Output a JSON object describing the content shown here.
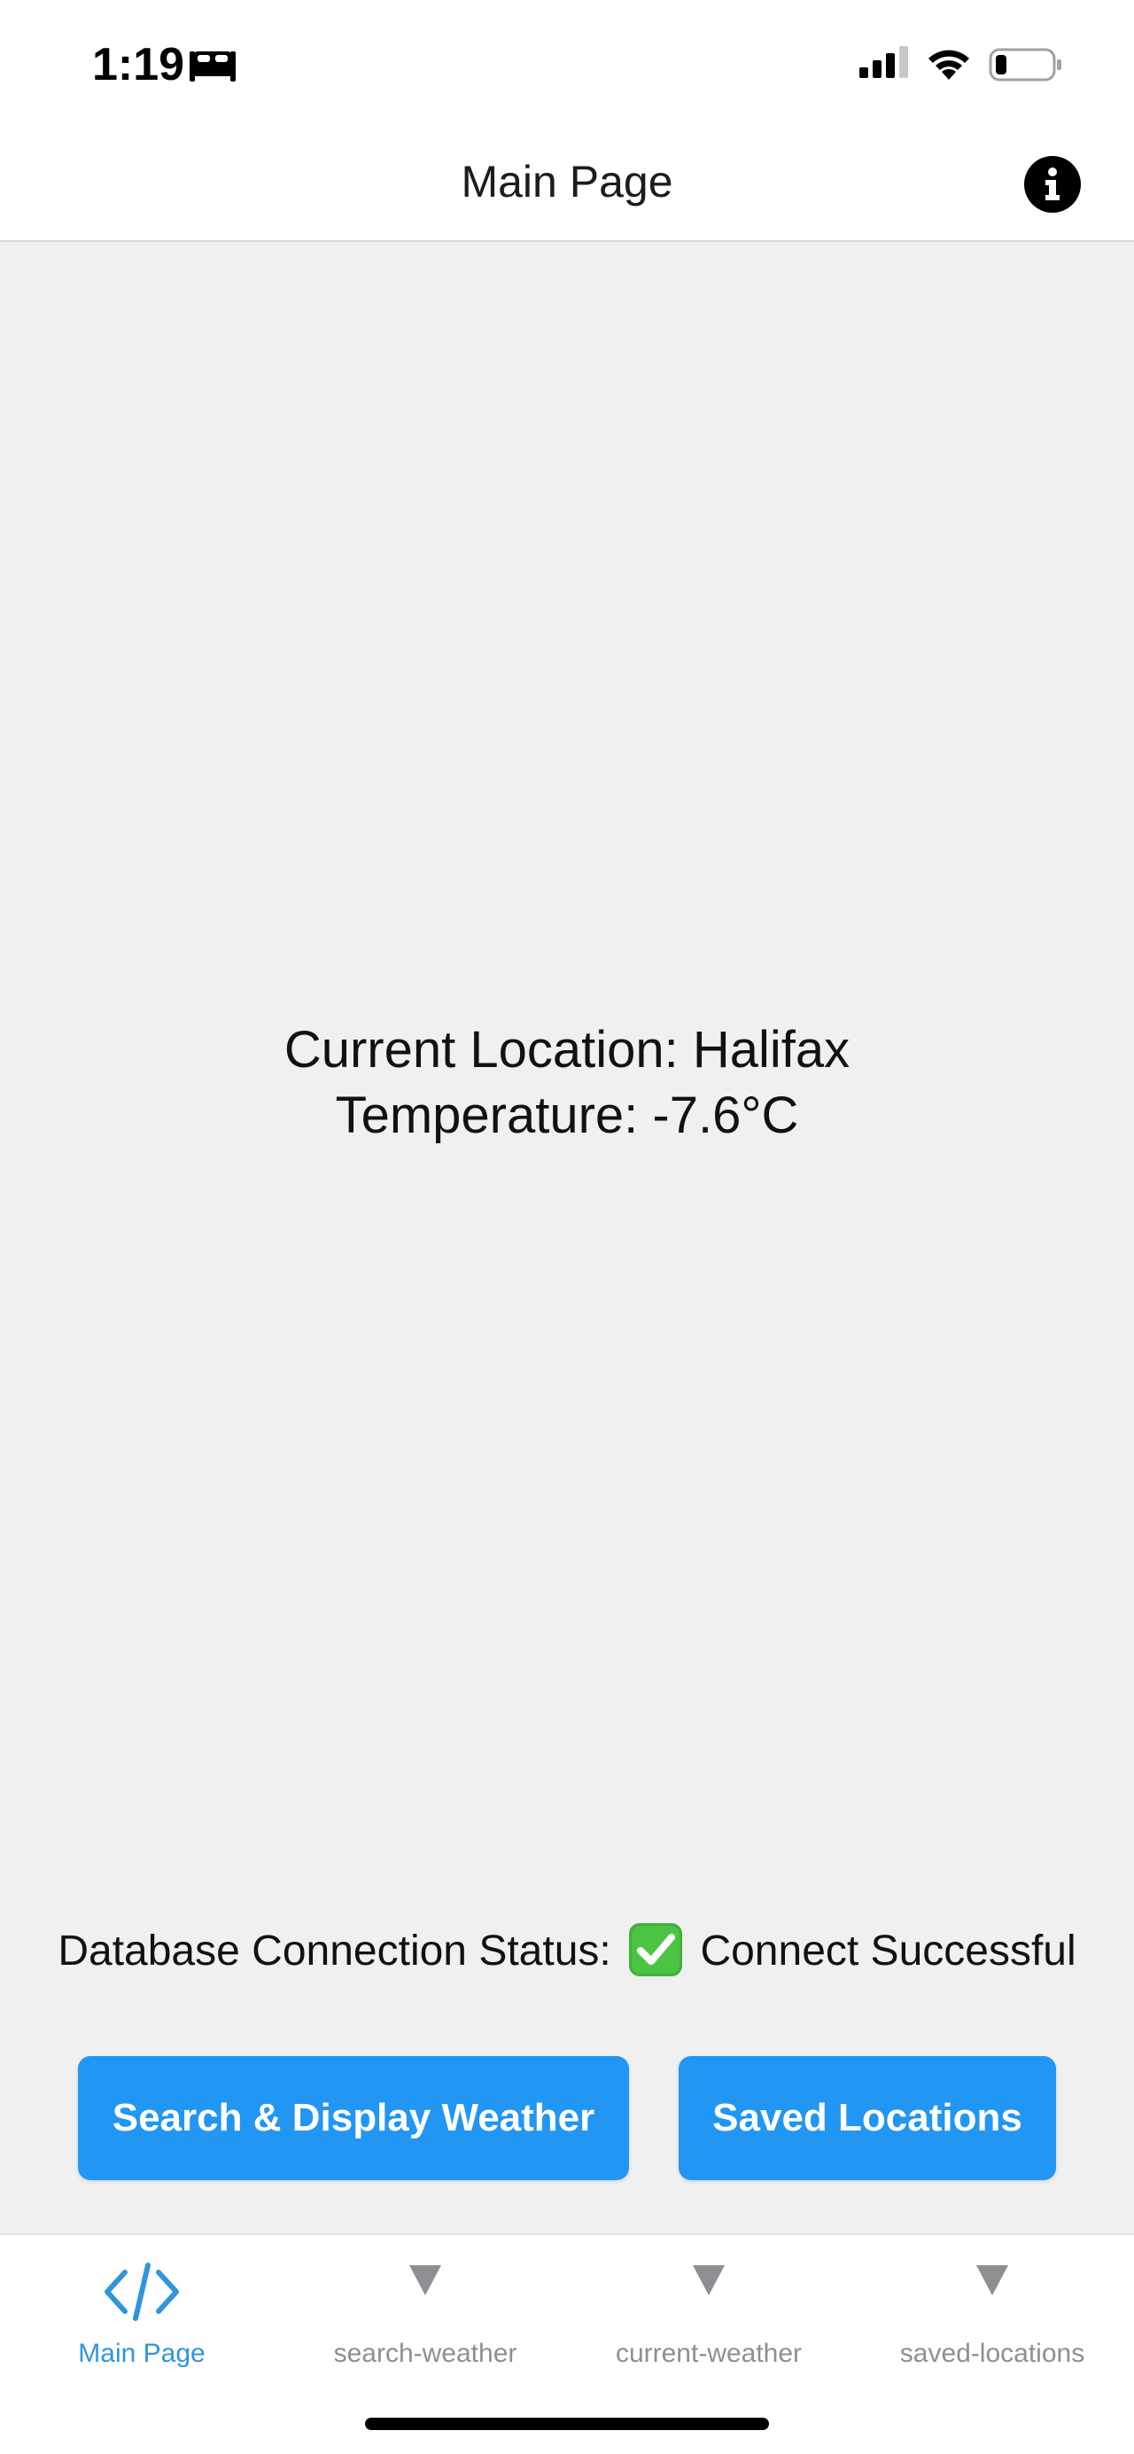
{
  "status_bar": {
    "time": "1:19",
    "focus_icon": "bed-icon",
    "signal_icon": "cellular-signal-icon",
    "wifi_icon": "wifi-icon",
    "battery_icon": "battery-icon"
  },
  "header": {
    "title": "Main Page",
    "info_icon": "info-icon"
  },
  "main": {
    "location_line": "Current Location: Halifax",
    "temperature_line": "Temperature: -7.6°C",
    "db_status_label": "Database Connection Status:",
    "db_status_icon": "check-mark-icon",
    "db_status_value": "Connect Successful"
  },
  "buttons": {
    "search_label": "Search & Display Weather",
    "saved_label": "Saved Locations"
  },
  "tabs": [
    {
      "label": "Main Page",
      "icon": "code-icon",
      "active": true
    },
    {
      "label": "search-weather",
      "icon": "triangle-down-icon",
      "active": false
    },
    {
      "label": "current-weather",
      "icon": "triangle-down-icon",
      "active": false
    },
    {
      "label": "saved-locations",
      "icon": "triangle-down-icon",
      "active": false
    }
  ],
  "colors": {
    "accent": "#2196f3",
    "active_tab": "#2f95dc",
    "inactive_tab": "#8e8e93",
    "background": "#f0f0f0",
    "success": "#34c759"
  }
}
